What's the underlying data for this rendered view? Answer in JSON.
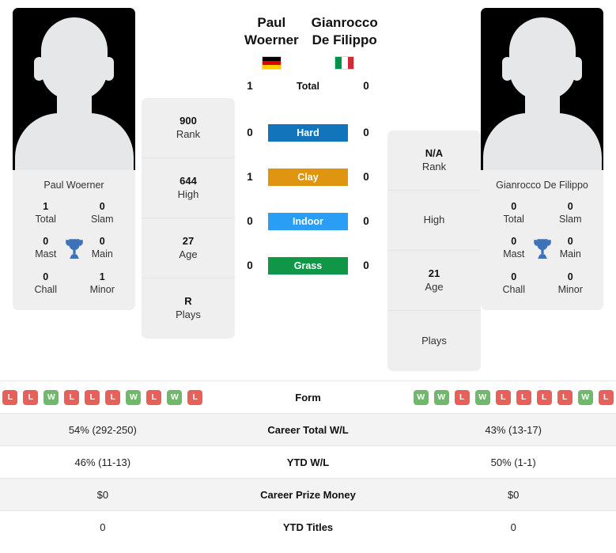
{
  "players": {
    "left": {
      "name": "Paul Woerner",
      "photo_caption": "Paul Woerner",
      "country": "Germany",
      "flag_colors": [
        "#000000",
        "#dd0000",
        "#ffce00"
      ],
      "flag_orientation": "horizontal",
      "titles": {
        "total_value": "1",
        "total_label": "Total",
        "slam_value": "0",
        "slam_label": "Slam",
        "mast_value": "0",
        "mast_label": "Mast",
        "main_value": "0",
        "main_label": "Main",
        "chall_value": "0",
        "chall_label": "Chall",
        "minor_value": "1",
        "minor_label": "Minor"
      },
      "ranking": [
        {
          "value": "900",
          "label": "Rank"
        },
        {
          "value": "644",
          "label": "High"
        },
        {
          "value": "27",
          "label": "Age"
        },
        {
          "value": "R",
          "label": "Plays"
        }
      ],
      "form": [
        "L",
        "L",
        "W",
        "L",
        "L",
        "L",
        "W",
        "L",
        "W",
        "L"
      ]
    },
    "right": {
      "name": "Gianrocco De Filippo",
      "photo_caption": "Gianrocco De Filippo",
      "country": "Italy",
      "flag_colors": [
        "#009246",
        "#ffffff",
        "#ce2b37"
      ],
      "flag_orientation": "vertical",
      "titles": {
        "total_value": "0",
        "total_label": "Total",
        "slam_value": "0",
        "slam_label": "Slam",
        "mast_value": "0",
        "mast_label": "Mast",
        "main_value": "0",
        "main_label": "Main",
        "chall_value": "0",
        "chall_label": "Chall",
        "minor_value": "0",
        "minor_label": "Minor"
      },
      "ranking": [
        {
          "value": "N/A",
          "label": "Rank"
        },
        {
          "value": "",
          "label": "High"
        },
        {
          "value": "21",
          "label": "Age"
        },
        {
          "value": "",
          "label": "Plays"
        }
      ],
      "form": [
        "W",
        "W",
        "L",
        "W",
        "L",
        "L",
        "L",
        "L",
        "W",
        "L"
      ]
    }
  },
  "head_to_head": [
    {
      "left": "1",
      "label": "Total",
      "right": "0",
      "color": "none",
      "text_color": "#111111"
    },
    {
      "left": "0",
      "label": "Hard",
      "right": "0",
      "color": "#1275bc",
      "text_color": "#ffffff"
    },
    {
      "left": "1",
      "label": "Clay",
      "right": "0",
      "color": "#e09510",
      "text_color": "#ffffff"
    },
    {
      "left": "0",
      "label": "Indoor",
      "right": "0",
      "color": "#2a9df4",
      "text_color": "#ffffff"
    },
    {
      "left": "0",
      "label": "Grass",
      "right": "0",
      "color": "#109647",
      "text_color": "#ffffff"
    }
  ],
  "comparison_table": [
    {
      "left": "",
      "label": "Form",
      "right": "",
      "type": "form"
    },
    {
      "left": "54% (292-250)",
      "label": "Career Total W/L",
      "right": "43% (13-17)",
      "type": "text"
    },
    {
      "left": "46% (11-13)",
      "label": "YTD W/L",
      "right": "50% (1-1)",
      "type": "text"
    },
    {
      "left": "$0",
      "label": "Career Prize Money",
      "right": "$0",
      "type": "text"
    },
    {
      "left": "0",
      "label": "YTD Titles",
      "right": "0",
      "type": "text"
    }
  ],
  "colors": {
    "win_badge": "#70b96c",
    "loss_badge": "#e8605a",
    "card_bg": "#efefef",
    "trophy": "#3c72b8"
  }
}
